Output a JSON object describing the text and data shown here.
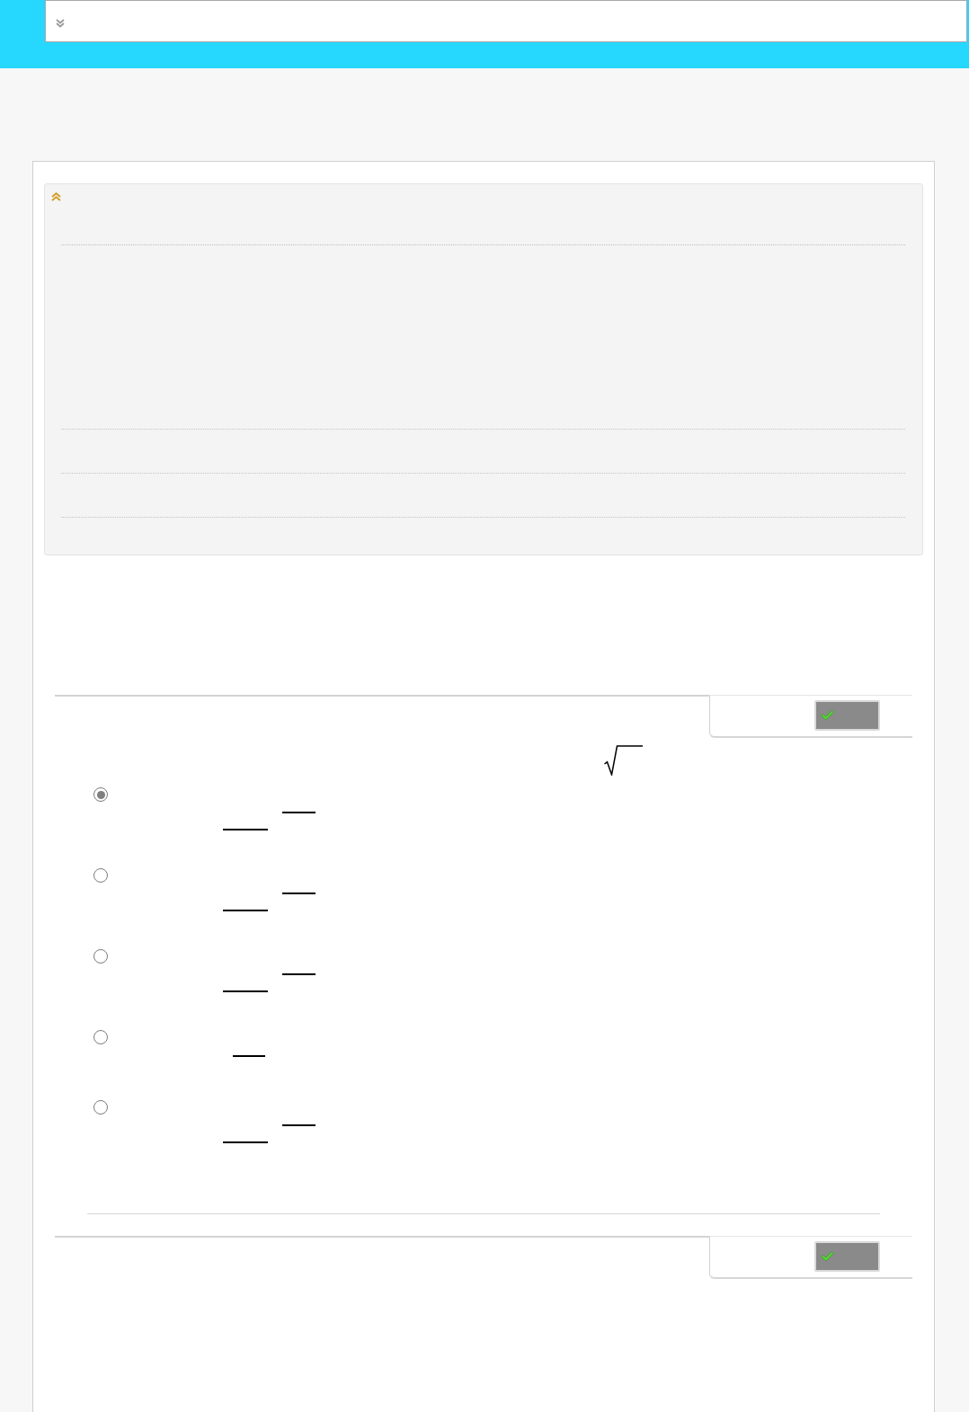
{
  "top_bar": {
    "expanded": false
  },
  "info_panel": {
    "expanded": true
  },
  "questions": [
    {
      "radical": true,
      "options": [
        {
          "kind": "compound",
          "selected": true
        },
        {
          "kind": "compound",
          "selected": false
        },
        {
          "kind": "compound",
          "selected": false
        },
        {
          "kind": "simple",
          "selected": false
        },
        {
          "kind": "compound",
          "selected": false
        }
      ]
    },
    {
      "radical": false
    }
  ]
}
